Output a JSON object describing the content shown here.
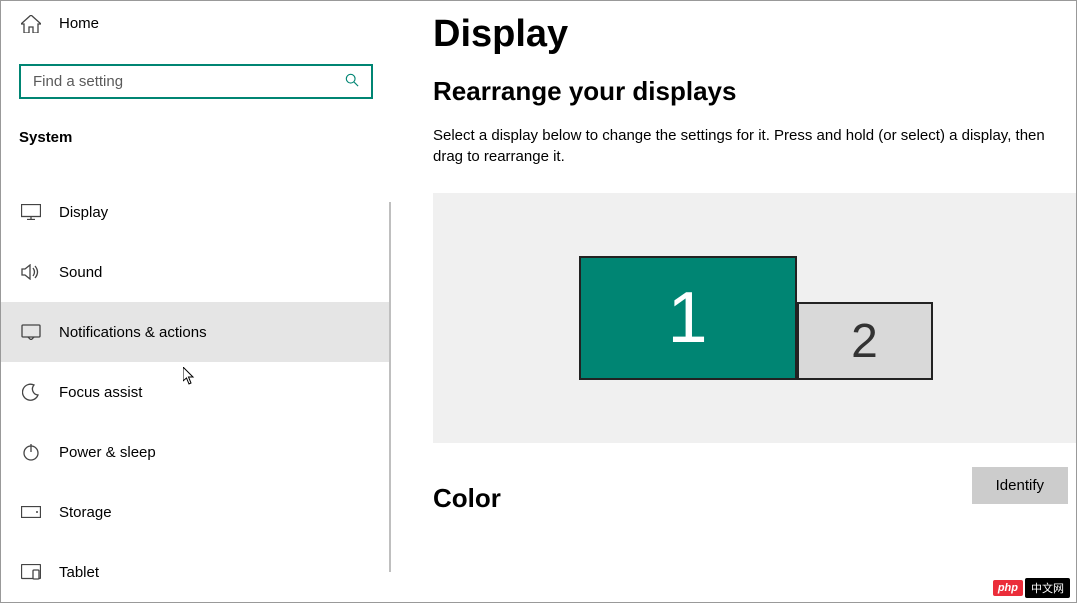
{
  "sidebar": {
    "home_label": "Home",
    "search_placeholder": "Find a setting",
    "category": "System",
    "items": [
      {
        "label": "Display",
        "icon": "display-icon"
      },
      {
        "label": "Sound",
        "icon": "sound-icon"
      },
      {
        "label": "Notifications & actions",
        "icon": "notifications-icon"
      },
      {
        "label": "Focus assist",
        "icon": "moon-icon"
      },
      {
        "label": "Power & sleep",
        "icon": "power-icon"
      },
      {
        "label": "Storage",
        "icon": "storage-icon"
      },
      {
        "label": "Tablet",
        "icon": "tablet-icon"
      }
    ]
  },
  "main": {
    "title": "Display",
    "rearrange_title": "Rearrange your displays",
    "rearrange_desc": "Select a display below to change the settings for it. Press and hold (or select) a display, then drag to rearrange it.",
    "displays": [
      {
        "id": "1",
        "primary": true
      },
      {
        "id": "2",
        "primary": false
      }
    ],
    "identify_label": "Identify",
    "color_title": "Color"
  },
  "watermark": {
    "red": "php",
    "black": "中文网"
  }
}
